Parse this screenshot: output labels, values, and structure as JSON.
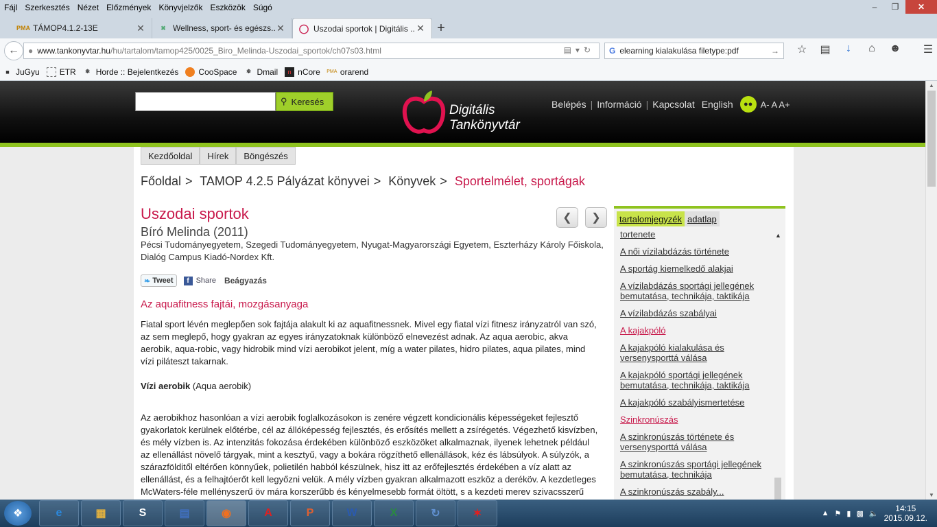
{
  "menubar": [
    "Fájl",
    "Szerkesztés",
    "Nézet",
    "Előzmények",
    "Könyvjelzők",
    "Eszközök",
    "Súgó"
  ],
  "tabs": [
    {
      "label": "TÁMOP4.1.2-13E",
      "icon": "pma-icon"
    },
    {
      "label": "Wellness, sport- és egészs...",
      "icon": "puzzle-icon"
    },
    {
      "label": "Uszodai sportok | Digitális ...",
      "icon": "apple-icon"
    }
  ],
  "url": {
    "host": "www.tankonyvtar.hu",
    "path": "/hu/tartalom/tamop425/0025_Biro_Melinda-Uszodai_sportok/ch07s03.html"
  },
  "search_value": "elearning kialakulása filetype:pdf",
  "bookmarks": [
    "JuGyu",
    "ETR",
    "Horde :: Bejelentkezés",
    "CooSpace",
    "Dmail",
    "nCore",
    "orarend"
  ],
  "site": {
    "search_btn": "Keresés",
    "logo_line1": "Digitális",
    "logo_line2": "Tankönyvtár",
    "links": [
      "Belépés",
      "Információ",
      "Kapcsolat",
      "English"
    ],
    "font_sizes": "A- A A+"
  },
  "subnav": [
    "Kezdőoldal",
    "Hírek",
    "Böngészés"
  ],
  "breadcrumb": [
    "Főoldal",
    "TAMOP 4.2.5 Pályázat könyvei",
    "Könyvek",
    "Sportelmélet, sportágak"
  ],
  "book": {
    "title": "Uszodai sportok",
    "author": "Bíró Melinda (2011)",
    "publisher": "Pécsi Tudományegyetem, Szegedi Tudományegyetem, Nyugat-Magyarországi Egyetem, Eszterházy Károly Főiskola, Dialóg Campus Kiadó-Nordex Kft."
  },
  "share": {
    "tweet": "Tweet",
    "fb": "Share",
    "embed": "Beágyazás"
  },
  "section_title": "Az aquafitness fajtái, mozgásanyaga",
  "content": {
    "p1": "Fiatal sport lévén meglepően sok fajtája alakult ki az aquafitnessnek. Mivel egy fiatal vízi fitnesz irányzatról van szó, az sem meglepő, hogy gyakran az egyes irányzatoknak különböző elnevezést adnak. Az aqua aerobic, akva aerobik, aqua-robic, vagy hidrobik mind vízi aerobikot jelent, míg a water pilates, hidro pilates, aqua pilates, mind vízi piláteszt takarnak.",
    "p2_bold": "Vízi aerobik",
    "p2_rest": " (Aqua aerobik)",
    "p3": "Az aerobikhoz hasonlóan a vízi aerobik foglalkozásokon is zenére végzett kondicionális képességeket fejlesztő gyakorlatok kerülnek előtérbe, cél az állóképesség fejlesztés, és erősítés mellett a zsírégetés. Végezhető kisvízben, és mély vízben is. Az intenzitás fokozása érdekében különböző eszközöket alkalmaznak, ilyenek lehetnek például az ellenállást növelő tárgyak, mint a kesztyű, vagy a bokára rögzíthető ellenállások, kéz és lábsúlyok. A súlyzók, a szárazfölditől eltérően könnyűek, polietilén habból készülnek, hisz itt az erőfejlesztés érdekében a víz alatt az ellenállást, és a felhajtóerőt kell legyőzni velük. A mély vízben gyakran alkalmazott eszköz a deréköv. A kezdetleges McWaters-féle mellényszerű öv mára korszerűbb és kényelmesebb formát öltött, s a kezdeti merev szivacsszerű anyagát egy rugalmas, a"
  },
  "sidebar": {
    "tab_toc": "tartalomjegyzék",
    "tab_data": "adatlap",
    "items": [
      {
        "label": "tortenete",
        "hi": false
      },
      {
        "label": "A női vízilabdázás története",
        "hi": false
      },
      {
        "label": "A sportág kiemelkedő alakjai",
        "hi": false
      },
      {
        "label": "A vízilabdázás sportági jellegének bemutatása, technikája, taktikája",
        "hi": false
      },
      {
        "label": "A vízilabdázás szabályai",
        "hi": false
      },
      {
        "label": "A kajakpóló",
        "hi": true
      },
      {
        "label": "A kajakpóló kialakulása és versenysporttá válása",
        "hi": false
      },
      {
        "label": "A kajakpóló sportági jellegének bemutatása, technikája, taktikája",
        "hi": false
      },
      {
        "label": "A kajakpóló szabályismertetése",
        "hi": false
      },
      {
        "label": "Szinkronúszás",
        "hi": true
      },
      {
        "label": "A szinkronúszás története és versenysporttá válása",
        "hi": false
      },
      {
        "label": "A szinkronúszás sportági jellegének bemutatása, technikája",
        "hi": false
      },
      {
        "label": "A szinkronúszás szabály...",
        "hi": false
      }
    ]
  },
  "taskbar_apps": [
    "ie-icon",
    "explorer-icon",
    "skype-icon",
    "save-icon",
    "firefox-icon",
    "acrobat-icon",
    "powerpoint-icon",
    "word-icon",
    "excel-icon",
    "sync-icon",
    "paint-icon"
  ],
  "clock": {
    "time": "14:15",
    "date": "2015.09.12."
  },
  "colors": {
    "accent_green": "#8fc31f",
    "brand_red": "#c8194b"
  }
}
